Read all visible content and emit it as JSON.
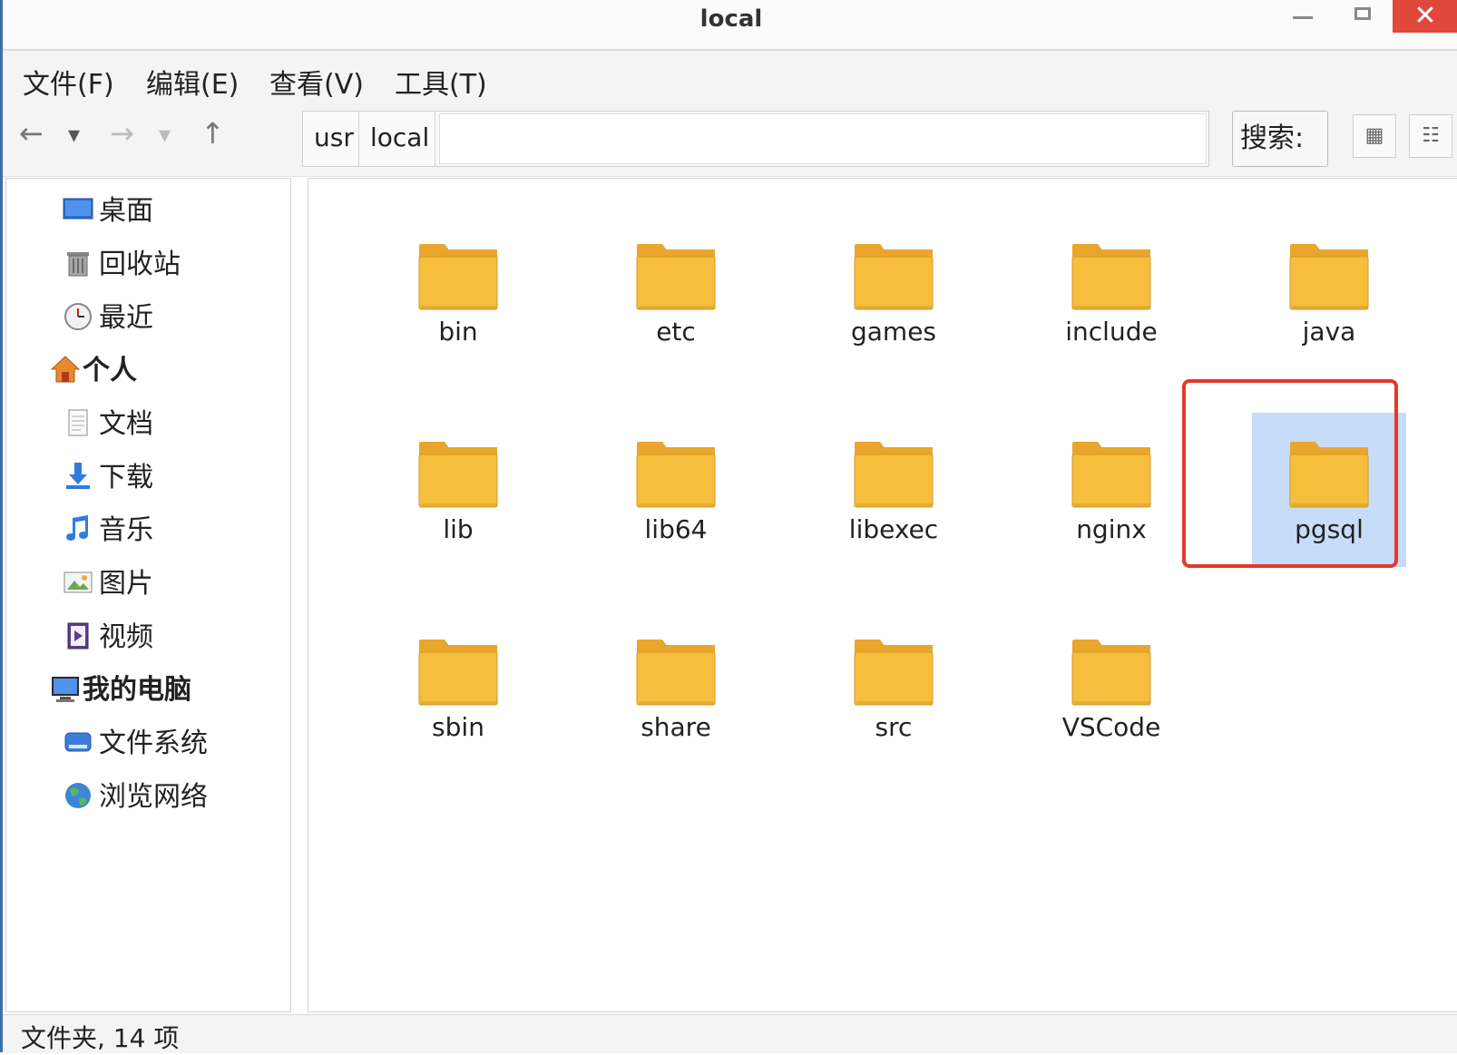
{
  "window": {
    "title": "local",
    "close_glyph": "✕"
  },
  "menu": [
    "文件(F)",
    "编辑(E)",
    "查看(V)",
    "工具(T)"
  ],
  "toolbar": {
    "back_glyph": "←",
    "back_dropdown_glyph": "▾",
    "forward_glyph": "→",
    "forward_dropdown_glyph": "▾",
    "up_glyph": "↑",
    "path": [
      "usr",
      "local"
    ],
    "search_label": "搜索:",
    "icon_view_glyph": "▦",
    "list_view_glyph": "☷"
  },
  "sidebar": {
    "items": [
      {
        "label": "桌面",
        "icon": "desktop-icon"
      },
      {
        "label": "回收站",
        "icon": "trash-icon"
      },
      {
        "label": "最近",
        "icon": "clock-icon"
      },
      {
        "label": "个人",
        "icon": "home-icon",
        "header": true
      },
      {
        "label": "文档",
        "icon": "document-icon"
      },
      {
        "label": "下载",
        "icon": "download-icon"
      },
      {
        "label": "音乐",
        "icon": "music-icon"
      },
      {
        "label": "图片",
        "icon": "picture-icon"
      },
      {
        "label": "视频",
        "icon": "video-icon"
      },
      {
        "label": "我的电脑",
        "icon": "computer-icon",
        "header": true
      },
      {
        "label": "文件系统",
        "icon": "drive-icon"
      },
      {
        "label": "浏览网络",
        "icon": "globe-icon"
      }
    ]
  },
  "folders": [
    {
      "name": "bin"
    },
    {
      "name": "etc"
    },
    {
      "name": "games"
    },
    {
      "name": "include"
    },
    {
      "name": "java"
    },
    {
      "name": "lib"
    },
    {
      "name": "lib64"
    },
    {
      "name": "libexec"
    },
    {
      "name": "nginx"
    },
    {
      "name": "pgsql",
      "selected": true
    },
    {
      "name": "sbin"
    },
    {
      "name": "share"
    },
    {
      "name": "src"
    },
    {
      "name": "VSCode"
    }
  ],
  "status": {
    "text": "文件夹, 14 项"
  },
  "colors": {
    "folder": "#f6be3c",
    "folder_tab": "#e9a52c",
    "selection": "#c6dcf8",
    "highlight_border": "#e2392c",
    "close_button": "#e0483e"
  }
}
